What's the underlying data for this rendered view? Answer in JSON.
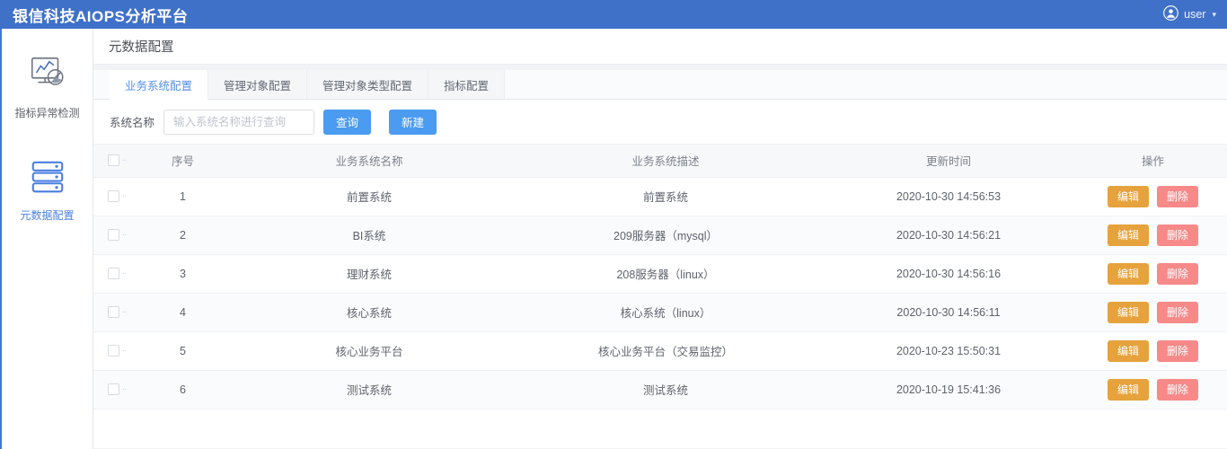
{
  "header": {
    "app_title": "银信科技AIOPS分析平台",
    "user_name": "user",
    "avatar_icon": "user-circle-icon",
    "chevron_icon": "chevron-down-icon",
    "background_color": "#4071c9"
  },
  "sidebar": {
    "items": [
      {
        "label": "指标异常检测",
        "icon": "chart-monitor-icon",
        "active": false
      },
      {
        "label": "元数据配置",
        "icon": "database-stack-icon",
        "active": true
      }
    ],
    "active_color": "#4a7fe0"
  },
  "page": {
    "title": "元数据配置"
  },
  "tabs": [
    {
      "label": "业务系统配置",
      "active": true
    },
    {
      "label": "管理对象配置",
      "active": false
    },
    {
      "label": "管理对象类型配置",
      "active": false
    },
    {
      "label": "指标配置",
      "active": false
    }
  ],
  "search": {
    "label": "系统名称",
    "placeholder": "输入系统名称进行查询",
    "value": "",
    "query_button": "查询",
    "create_button": "新建"
  },
  "table": {
    "columns": [
      "序号",
      "业务系统名称",
      "业务系统描述",
      "更新时间",
      "操作"
    ],
    "action_labels": {
      "edit": "编辑",
      "delete": "删除"
    },
    "action_colors": {
      "edit": "#e6a23c",
      "delete": "#f78989"
    },
    "rows": [
      {
        "index": "1",
        "name": "前置系统",
        "desc": "前置系统",
        "time": "2020-10-30 14:56:53"
      },
      {
        "index": "2",
        "name": "BI系统",
        "desc": "209服务器（mysql）",
        "time": "2020-10-30 14:56:21"
      },
      {
        "index": "3",
        "name": "理财系统",
        "desc": "208服务器（linux）",
        "time": "2020-10-30 14:56:16"
      },
      {
        "index": "4",
        "name": "核心系统",
        "desc": "核心系统（linux）",
        "time": "2020-10-30 14:56:11"
      },
      {
        "index": "5",
        "name": "核心业务平台",
        "desc": "核心业务平台（交易监控）",
        "time": "2020-10-23 15:50:31"
      },
      {
        "index": "6",
        "name": "测试系统",
        "desc": "测试系统",
        "time": "2020-10-19 15:41:36"
      }
    ]
  }
}
